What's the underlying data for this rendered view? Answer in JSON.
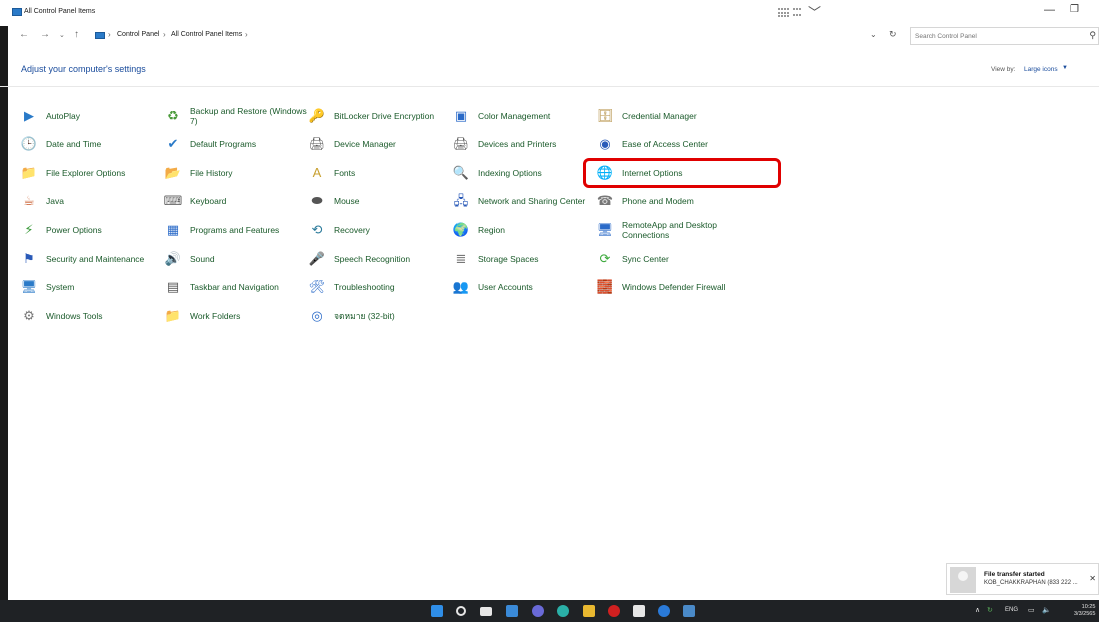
{
  "window": {
    "title": "All Control Panel Items",
    "minimize": "—",
    "restore": "❐"
  },
  "address": {
    "crumbs": [
      "Control Panel",
      "All Control Panel Items"
    ],
    "search_placeholder": "Search Control Panel"
  },
  "header": {
    "title": "Adjust your computer's settings",
    "view_by_label": "View by:",
    "view_by_value": "Large icons"
  },
  "items": [
    {
      "label": "AutoPlay",
      "icon": "autoplay-icon",
      "glyph": "▶",
      "color": "#2a7ac8"
    },
    {
      "label": "Backup and Restore (Windows 7)",
      "icon": "backup-icon",
      "glyph": "♻",
      "color": "#4a9a3a"
    },
    {
      "label": "BitLocker Drive Encryption",
      "icon": "bitlocker-key-icon",
      "glyph": "🔑",
      "color": "#a08a4a"
    },
    {
      "label": "Color Management",
      "icon": "color-management-icon",
      "glyph": "▣",
      "color": "#2a6ac8"
    },
    {
      "label": "Credential Manager",
      "icon": "credential-manager-icon",
      "glyph": "🗄",
      "color": "#b08a3a"
    },
    {
      "label": "Date and Time",
      "icon": "date-time-icon",
      "glyph": "🕒",
      "color": "#2a7ac8"
    },
    {
      "label": "Default Programs",
      "icon": "default-programs-icon",
      "glyph": "✔",
      "color": "#2a7ac8"
    },
    {
      "label": "Device Manager",
      "icon": "device-manager-icon",
      "glyph": "🖨",
      "color": "#555555"
    },
    {
      "label": "Devices and Printers",
      "icon": "devices-printers-icon",
      "glyph": "🖨",
      "color": "#555555"
    },
    {
      "label": "Ease of Access Center",
      "icon": "ease-of-access-icon",
      "glyph": "◉",
      "color": "#2a5ab8"
    },
    {
      "label": "File Explorer Options",
      "icon": "file-explorer-options-icon",
      "glyph": "📁",
      "color": "#e8b830"
    },
    {
      "label": "File History",
      "icon": "file-history-icon",
      "glyph": "📂",
      "color": "#e8b830"
    },
    {
      "label": "Fonts",
      "icon": "fonts-icon",
      "glyph": "A",
      "color": "#c8a030"
    },
    {
      "label": "Indexing Options",
      "icon": "indexing-options-icon",
      "glyph": "🔍",
      "color": "#666666"
    },
    {
      "label": "Internet Options",
      "icon": "internet-options-icon",
      "glyph": "🌐",
      "color": "#2a8ac8"
    },
    {
      "label": "Java",
      "icon": "java-icon",
      "glyph": "☕",
      "color": "#c85a2a"
    },
    {
      "label": "Keyboard",
      "icon": "keyboard-icon",
      "glyph": "⌨",
      "color": "#666666"
    },
    {
      "label": "Mouse",
      "icon": "mouse-icon",
      "glyph": "⬬",
      "color": "#555555"
    },
    {
      "label": "Network and Sharing Center",
      "icon": "network-sharing-icon",
      "glyph": "🖧",
      "color": "#2a5ab8"
    },
    {
      "label": "Phone and Modem",
      "icon": "phone-modem-icon",
      "glyph": "☎",
      "color": "#777777"
    },
    {
      "label": "Power Options",
      "icon": "power-options-icon",
      "glyph": "⚡",
      "color": "#3a9a3a"
    },
    {
      "label": "Programs and Features",
      "icon": "programs-features-icon",
      "glyph": "▦",
      "color": "#2a6ac8"
    },
    {
      "label": "Recovery",
      "icon": "recovery-icon",
      "glyph": "⟲",
      "color": "#2a7a9a"
    },
    {
      "label": "Region",
      "icon": "region-icon",
      "glyph": "🌍",
      "color": "#2a7ac8"
    },
    {
      "label": "RemoteApp and Desktop Connections",
      "icon": "remoteapp-icon",
      "glyph": "🖥",
      "color": "#2a6ac8"
    },
    {
      "label": "Security and Maintenance",
      "icon": "security-maintenance-flag-icon",
      "glyph": "⚑",
      "color": "#2a5ab8"
    },
    {
      "label": "Sound",
      "icon": "sound-icon",
      "glyph": "🔊",
      "color": "#777777"
    },
    {
      "label": "Speech Recognition",
      "icon": "speech-recognition-icon",
      "glyph": "🎤",
      "color": "#777777"
    },
    {
      "label": "Storage Spaces",
      "icon": "storage-spaces-icon",
      "glyph": "≣",
      "color": "#777777"
    },
    {
      "label": "Sync Center",
      "icon": "sync-center-icon",
      "glyph": "⟳",
      "color": "#3aa83a"
    },
    {
      "label": "System",
      "icon": "system-icon",
      "glyph": "🖥",
      "color": "#2a7ac8"
    },
    {
      "label": "Taskbar and Navigation",
      "icon": "taskbar-navigation-icon",
      "glyph": "▤",
      "color": "#555555"
    },
    {
      "label": "Troubleshooting",
      "icon": "troubleshooting-icon",
      "glyph": "🛠",
      "color": "#2a6ac8"
    },
    {
      "label": "User Accounts",
      "icon": "user-accounts-icon",
      "glyph": "👥",
      "color": "#6a8a3a"
    },
    {
      "label": "Windows Defender Firewall",
      "icon": "firewall-icon",
      "glyph": "🧱",
      "color": "#a04a2a"
    },
    {
      "label": "Windows Tools",
      "icon": "windows-tools-icon",
      "glyph": "⚙",
      "color": "#777777"
    },
    {
      "label": "Work Folders",
      "icon": "work-folders-icon",
      "glyph": "📁",
      "color": "#2a6ac8"
    },
    {
      "label": "จดหมาย (32-bit)",
      "icon": "mail-icon",
      "glyph": "◎",
      "color": "#2a6ac8"
    }
  ],
  "highlighted_item": "Internet Options",
  "toast": {
    "title": "File transfer started",
    "body": "KOB_CHAKKRAPHAN (833 222 ..."
  },
  "tray": {
    "language": "ENG",
    "time": "10:25",
    "date": "3/3/2565"
  }
}
